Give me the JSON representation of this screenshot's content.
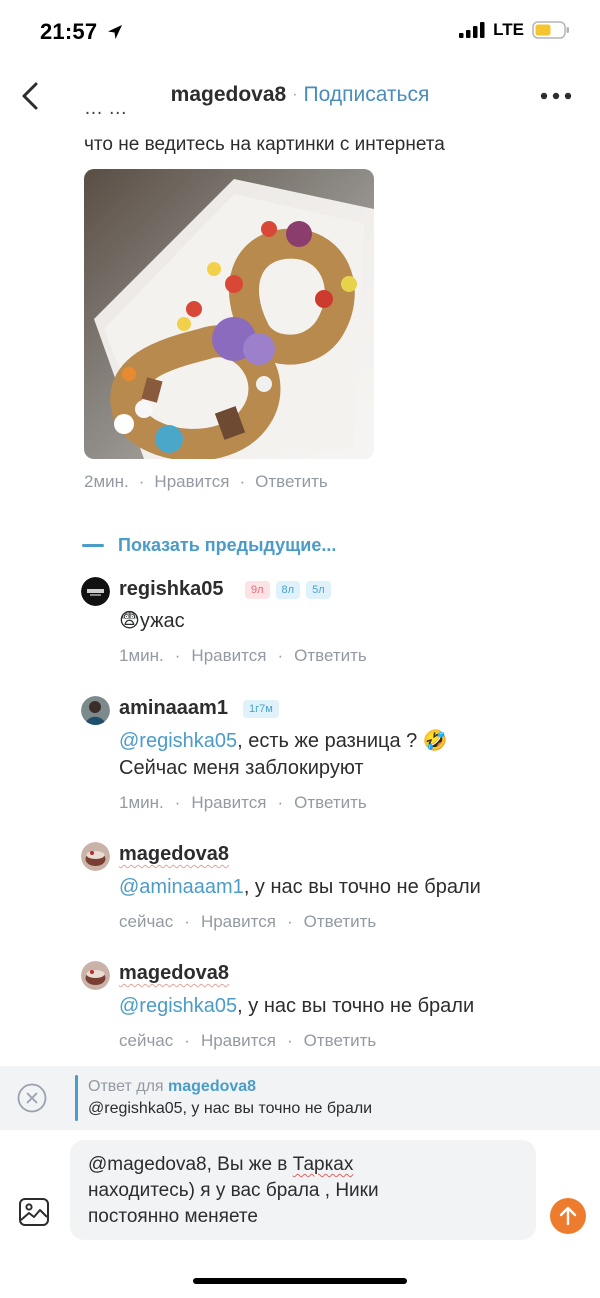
{
  "status_bar": {
    "time": "21:57",
    "network": "LTE"
  },
  "nav": {
    "username": "magedova8",
    "separator": "·",
    "subscribe_label": "Подписаться"
  },
  "post": {
    "text_clipped": "…                                                    …",
    "text_line2": "что не ведитесь на картинки с интернета",
    "meta": {
      "time": "2мин.",
      "like": "Нравится",
      "reply": "Ответить"
    }
  },
  "show_previous": "Показать предыдущие...",
  "comments": [
    {
      "username": "regishka05",
      "badges": [
        "9л",
        "8л",
        "5л"
      ],
      "emoji": "😨",
      "text": "ужас",
      "time": "1мин.",
      "like": "Нравится",
      "reply": "Ответить"
    },
    {
      "username": "aminaaam1",
      "badges": [
        "1г7м"
      ],
      "mention": "@regishka05",
      "text_after_mention": ", есть же разница ? 🤣",
      "text_line2": "Сейчас меня заблокируют",
      "time": "1мин.",
      "like": "Нравится",
      "reply": "Ответить"
    },
    {
      "username": "magedova8",
      "mention": "@aminaaam1",
      "text_after_mention": ",  у нас вы точно не брали",
      "time": "сейчас",
      "like": "Нравится",
      "reply": "Ответить"
    },
    {
      "username": "magedova8",
      "mention": "@regishka05",
      "text_after_mention": ", у нас вы точно не брали",
      "time": "сейчас",
      "like": "Нравится",
      "reply": "Ответить"
    }
  ],
  "meta_separator": "·",
  "reply_to": {
    "prefix": "Ответ для",
    "username": "magedova8",
    "quote": "@regishka05, у нас вы точно не брали"
  },
  "composer": {
    "line1_before": "@magedova8, Вы же в ",
    "line1_wavy": "Тарках",
    "line2": "находитесь) я у вас брала , Ники",
    "line3": "постоянно меняете"
  },
  "colors": {
    "accent": "#4a9cc9",
    "send": "#ee7c2e",
    "meta": "#939aa3",
    "battery": "#f5c531"
  },
  "icons": {
    "back": "chevron-left-icon",
    "more": "more-horizontal-icon",
    "close": "close-circle-icon",
    "attach": "image-icon",
    "send": "arrow-up-icon",
    "signal": "signal-icon",
    "location": "location-arrow-icon",
    "battery": "battery-icon"
  }
}
